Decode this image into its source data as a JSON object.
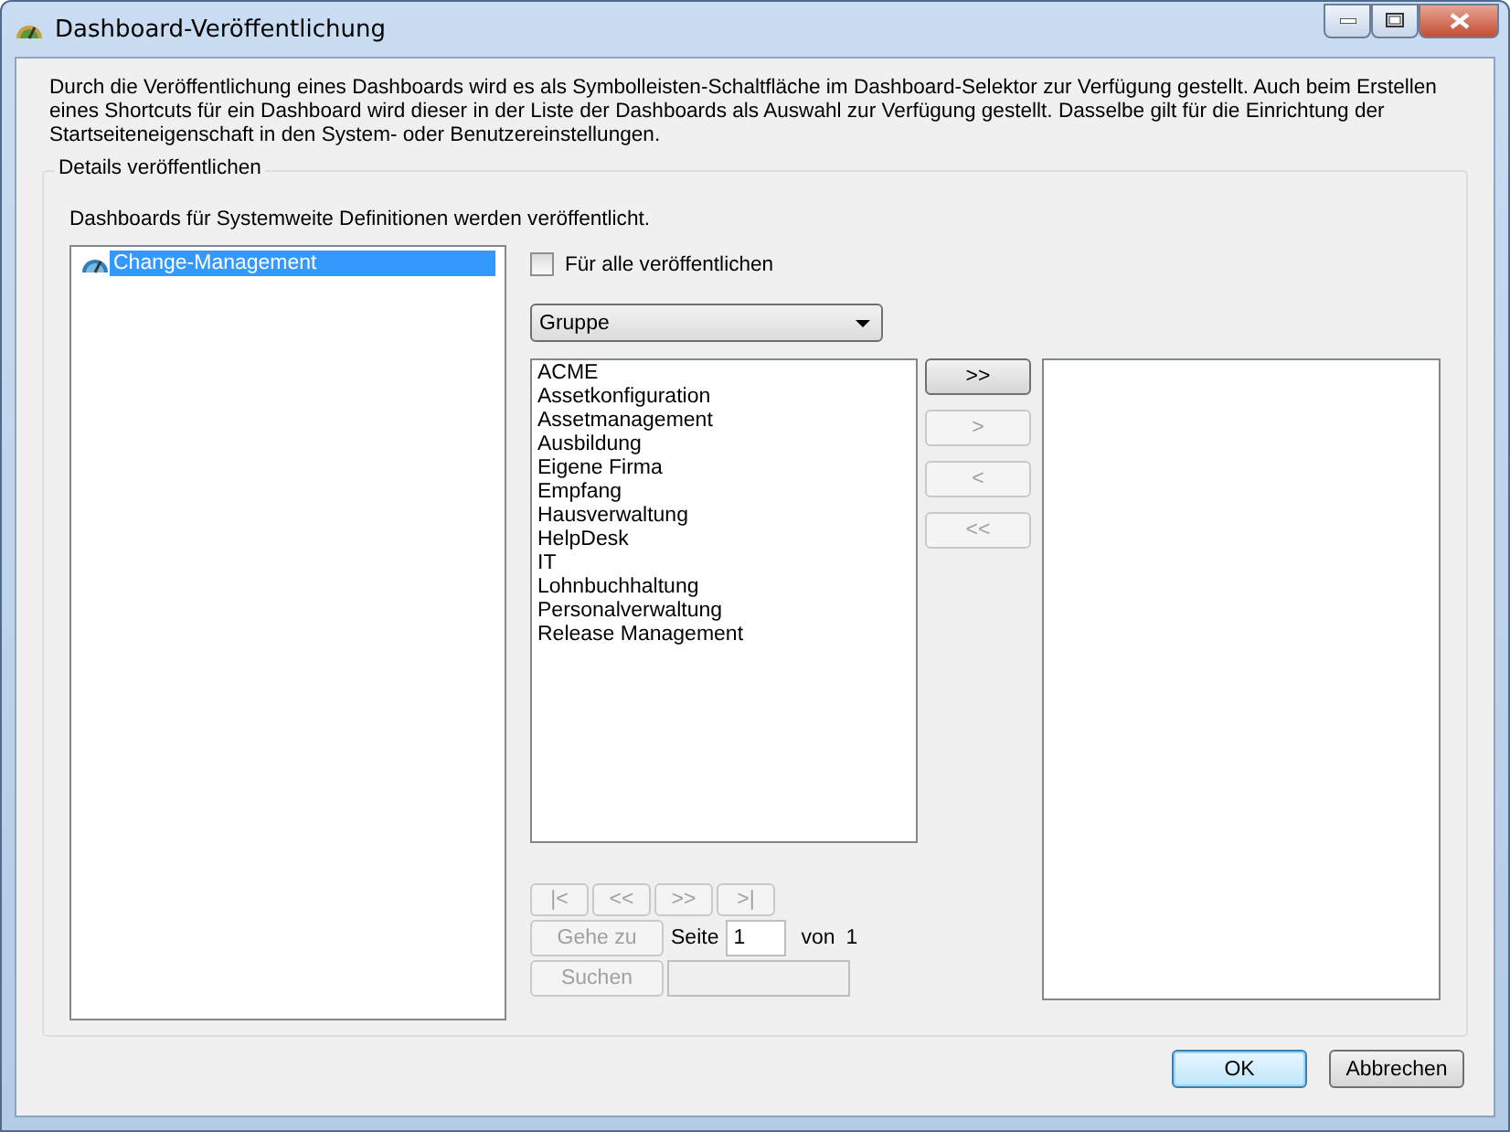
{
  "window": {
    "title": "Dashboard-Veröffentlichung"
  },
  "description": "Durch die Veröffentlichung eines Dashboards wird es als Symbolleisten-Schaltfläche im Dashboard-Selektor zur Verfügung gestellt. Auch beim Erstellen eines Shortcuts für ein Dashboard wird dieser in der Liste der Dashboards als Auswahl zur Verfügung gestellt. Dasselbe gilt für die Einrichtung der Startseiteneigenschaft in den System- oder Benutzereinstellungen.",
  "group": {
    "title": "Details veröffentlichen",
    "info": "Dashboards für Systemweite Definitionen werden veröffentlicht."
  },
  "dashboards": [
    {
      "label": "Change-Management",
      "selected": true
    }
  ],
  "publish_all": {
    "label": "Für alle veröffentlichen",
    "checked": false
  },
  "dropdown": {
    "value": "Gruppe"
  },
  "available": [
    "ACME",
    "Assetkonfiguration",
    "Assetmanagement",
    "Ausbildung",
    "Eigene Firma",
    "Empfang",
    "Hausverwaltung",
    "HelpDesk",
    "IT",
    "Lohnbuchhaltung",
    "Personalverwaltung",
    "Release Management"
  ],
  "move_buttons": [
    {
      "label": ">>",
      "disabled": false
    },
    {
      "label": ">",
      "disabled": true
    },
    {
      "label": "<",
      "disabled": true
    },
    {
      "label": "<<",
      "disabled": true
    }
  ],
  "pager_buttons": [
    {
      "label": "|<",
      "disabled": true
    },
    {
      "label": "<<",
      "disabled": true
    },
    {
      "label": ">>",
      "disabled": true
    },
    {
      "label": ">|",
      "disabled": true
    }
  ],
  "goto": {
    "label": "Gehe zu",
    "disabled": true
  },
  "page": {
    "label": "Seite",
    "value": "1",
    "of": "von",
    "total": "1"
  },
  "search": {
    "label": "Suchen",
    "disabled": true
  },
  "buttons": [
    {
      "label": "OK",
      "default": true
    },
    {
      "label": "Abbrechen",
      "default": false
    }
  ]
}
